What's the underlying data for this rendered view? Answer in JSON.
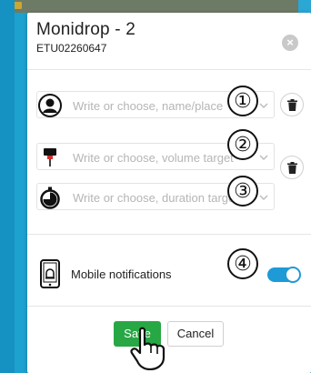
{
  "modal": {
    "title": "Monidrop - 2",
    "subtitle": "ETU02260647",
    "close_glyph": "×"
  },
  "fields": {
    "patient": {
      "placeholder": "Write or choose, name/place"
    },
    "volume": {
      "placeholder": "Write or choose, volume target"
    },
    "duration": {
      "placeholder": "Write or choose, duration target"
    }
  },
  "badges": [
    "①",
    "②",
    "③",
    "④"
  ],
  "notifications": {
    "label": "Mobile notifications",
    "enabled": true
  },
  "buttons": {
    "save": "Save",
    "cancel": "Cancel"
  },
  "icons": {
    "patient": "user-circle-icon",
    "volume": "drip-bag-icon",
    "duration": "stopwatch-icon",
    "delete": "trash-icon",
    "phone": "mobile-bell-icon",
    "pointer": "pointing-hand-icon"
  },
  "colors": {
    "accent": "#1e9ad6",
    "save": "#28a745",
    "backdrop": "#1da1cf"
  }
}
